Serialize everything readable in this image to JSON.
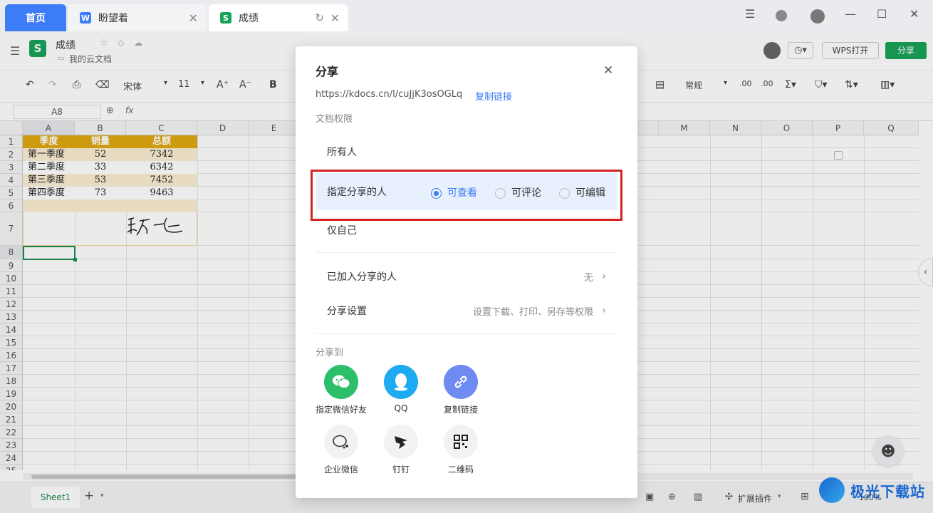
{
  "tabs": {
    "home": "首页",
    "doc1": "盼望着",
    "doc2": "成绩"
  },
  "doc": {
    "title": "成绩",
    "location": "我的云文档",
    "open_btn": "WPS打开",
    "share_btn": "分享"
  },
  "ribbon": {
    "font": "宋体",
    "size": "11",
    "bold": "B",
    "number_format": "常规"
  },
  "formula_bar": {
    "cell_ref": "A8",
    "fx": "fx"
  },
  "columns": [
    "A",
    "B",
    "C",
    "D",
    "E",
    "M",
    "N",
    "O",
    "P",
    "Q"
  ],
  "rows": [
    "1",
    "2",
    "3",
    "4",
    "5",
    "6",
    "7",
    "8",
    "9",
    "10",
    "11",
    "12",
    "13",
    "14",
    "15",
    "16",
    "17",
    "18",
    "19",
    "20",
    "21",
    "22",
    "23",
    "24",
    "25"
  ],
  "table": {
    "headers": [
      "季度",
      "销量",
      "总额"
    ],
    "rows": [
      [
        "第一季度",
        "52",
        "7342"
      ],
      [
        "第二季度",
        "33",
        "6342"
      ],
      [
        "第三季度",
        "53",
        "7452"
      ],
      [
        "第四季度",
        "73",
        "9463"
      ]
    ]
  },
  "sheet": {
    "name": "Sheet1",
    "add": "+",
    "plugins": "扩展插件",
    "zoom": "100%"
  },
  "dialog": {
    "title": "分享",
    "link": "https://kdocs.cn/l/cuJjK3osOGLq",
    "copy_link": "复制链接",
    "permission_label": "文档权限",
    "everyone": "所有人",
    "designated": "指定分享的人",
    "only_me": "仅自己",
    "options": [
      "可查看",
      "可评论",
      "可编辑"
    ],
    "joined_label": "已加入分享的人",
    "joined_value": "无",
    "settings_label": "分享设置",
    "settings_value": "设置下载、打印、另存等权限",
    "share_to": "分享到",
    "targets": [
      "指定微信好友",
      "QQ",
      "复制链接",
      "企业微信",
      "钉钉",
      "二维码"
    ]
  },
  "watermark": "极光下载站",
  "colors": {
    "accent": "#3d7cf7",
    "green": "#1aa35a",
    "highlight_box": "#d32323",
    "header_fill": "#e0a811",
    "row_fill": "#fbefd2"
  }
}
